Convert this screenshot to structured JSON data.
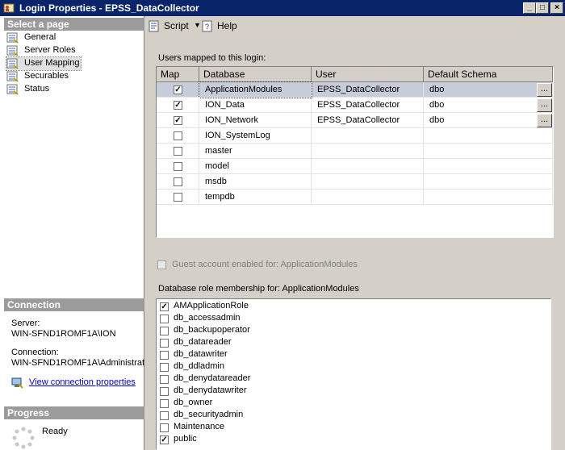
{
  "window": {
    "title": "Login Properties - EPSS_DataCollector",
    "minimize": "_",
    "maximize": "□",
    "close": "×"
  },
  "left": {
    "select_page_header": "Select a page",
    "pages": [
      {
        "label": "General"
      },
      {
        "label": "Server Roles"
      },
      {
        "label": "User Mapping",
        "selected": true
      },
      {
        "label": "Securables"
      },
      {
        "label": "Status"
      }
    ],
    "connection_header": "Connection",
    "server_label": "Server:",
    "server_value": "WIN-SFND1ROMF1A\\ION",
    "connection_label": "Connection:",
    "connection_value": "WIN-SFND1ROMF1A\\Administrat",
    "view_connection_link": "View connection properties",
    "progress_header": "Progress",
    "progress_status": "Ready"
  },
  "toolbar": {
    "script_label": "Script",
    "help_label": "Help"
  },
  "users_mapped": {
    "label": "Users mapped to this login:",
    "columns": [
      "Map",
      "Database",
      "User",
      "Default Schema"
    ],
    "rows": [
      {
        "map": true,
        "database": "ApplicationModules",
        "user": "EPSS_DataCollector",
        "schema": "dbo",
        "selected": true
      },
      {
        "map": true,
        "database": "ION_Data",
        "user": "EPSS_DataCollector",
        "schema": "dbo"
      },
      {
        "map": true,
        "database": "ION_Network",
        "user": "EPSS_DataCollector",
        "schema": "dbo"
      },
      {
        "map": false,
        "database": "ION_SystemLog",
        "user": "",
        "schema": ""
      },
      {
        "map": false,
        "database": "master",
        "user": "",
        "schema": ""
      },
      {
        "map": false,
        "database": "model",
        "user": "",
        "schema": ""
      },
      {
        "map": false,
        "database": "msdb",
        "user": "",
        "schema": ""
      },
      {
        "map": false,
        "database": "tempdb",
        "user": "",
        "schema": ""
      }
    ],
    "browse_button": "..."
  },
  "guest": {
    "label": "Guest account enabled for: ApplicationModules",
    "checked": false
  },
  "roles": {
    "label": "Database role membership for: ApplicationModules",
    "items": [
      {
        "name": "AMApplicationRole",
        "checked": true
      },
      {
        "name": "db_accessadmin",
        "checked": false
      },
      {
        "name": "db_backupoperator",
        "checked": false
      },
      {
        "name": "db_datareader",
        "checked": false
      },
      {
        "name": "db_datawriter",
        "checked": false
      },
      {
        "name": "db_ddladmin",
        "checked": false
      },
      {
        "name": "db_denydatareader",
        "checked": false
      },
      {
        "name": "db_denydatawriter",
        "checked": false
      },
      {
        "name": "db_owner",
        "checked": false
      },
      {
        "name": "db_securityadmin",
        "checked": false
      },
      {
        "name": "Maintenance",
        "checked": false
      },
      {
        "name": "public",
        "checked": true
      }
    ]
  }
}
